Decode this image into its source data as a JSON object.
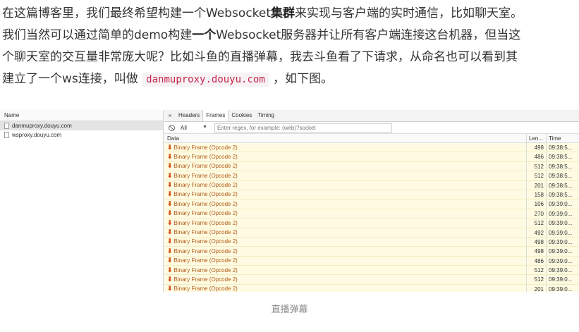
{
  "article": {
    "line1_a": "在这篇博客里，我们最终希望构建一个Websocket",
    "line1_b": "集群",
    "line1_c": "来实现与客户端的实时通信，比如聊天室。",
    "line2_a": "我们当然可以通过简单的demo构建",
    "line2_b": "一个",
    "line2_c": "Websocket服务器并让所有客户端连接这台机器，但当这",
    "line3": "个聊天室的交互量非常庞大呢？比如斗鱼的直播弹幕，我去斗鱼看了下请求，从命名也可以看到其",
    "line4_a": "建立了一个ws连接，叫做 ",
    "line4_code": "danmuproxy.douyu.com",
    "line4_b": " ，如下图。"
  },
  "network": {
    "header": "Name",
    "items": [
      "danmuproxy.douyu.com",
      "wsproxy.douyu.com"
    ]
  },
  "detail": {
    "close_glyph": "×",
    "tabs": [
      "Headers",
      "Frames",
      "Cookies",
      "Timing"
    ],
    "active_tab": "Frames",
    "filter_select": "All",
    "filter_placeholder": "Enter regex, for example: (web)?socket",
    "columns": {
      "data": "Data",
      "length": "Len...",
      "time": "Time"
    },
    "frames": [
      {
        "data": "Binary Frame (Opcode 2)",
        "length": "498",
        "time": "09:38:5..."
      },
      {
        "data": "Binary Frame (Opcode 2)",
        "length": "486",
        "time": "09:38:5..."
      },
      {
        "data": "Binary Frame (Opcode 2)",
        "length": "512",
        "time": "09:38:5..."
      },
      {
        "data": "Binary Frame (Opcode 2)",
        "length": "512",
        "time": "09:38:5..."
      },
      {
        "data": "Binary Frame (Opcode 2)",
        "length": "201",
        "time": "09:38:5..."
      },
      {
        "data": "Binary Frame (Opcode 2)",
        "length": "158",
        "time": "09:38:5..."
      },
      {
        "data": "Binary Frame (Opcode 2)",
        "length": "106",
        "time": "09:39:0..."
      },
      {
        "data": "Binary Frame (Opcode 2)",
        "length": "270",
        "time": "09:39:0..."
      },
      {
        "data": "Binary Frame (Opcode 2)",
        "length": "512",
        "time": "09:39:0..."
      },
      {
        "data": "Binary Frame (Opcode 2)",
        "length": "492",
        "time": "09:39:0..."
      },
      {
        "data": "Binary Frame (Opcode 2)",
        "length": "498",
        "time": "09:39:0..."
      },
      {
        "data": "Binary Frame (Opcode 2)",
        "length": "498",
        "time": "09:39:0..."
      },
      {
        "data": "Binary Frame (Opcode 2)",
        "length": "486",
        "time": "09:39:0..."
      },
      {
        "data": "Binary Frame (Opcode 2)",
        "length": "512",
        "time": "09:39:0..."
      },
      {
        "data": "Binary Frame (Opcode 2)",
        "length": "512",
        "time": "09:39:0..."
      },
      {
        "data": "Binary Frame (Opcode 2)",
        "length": "201",
        "time": "09:39:0..."
      }
    ],
    "frame_icon": "down-arrow-icon"
  },
  "caption": "直播弹幕",
  "colors": {
    "frame_text": "#b15a14",
    "frame_bg": "#fffbe2",
    "code_text": "#c7254e",
    "code_bg": "#f7f2f4"
  }
}
